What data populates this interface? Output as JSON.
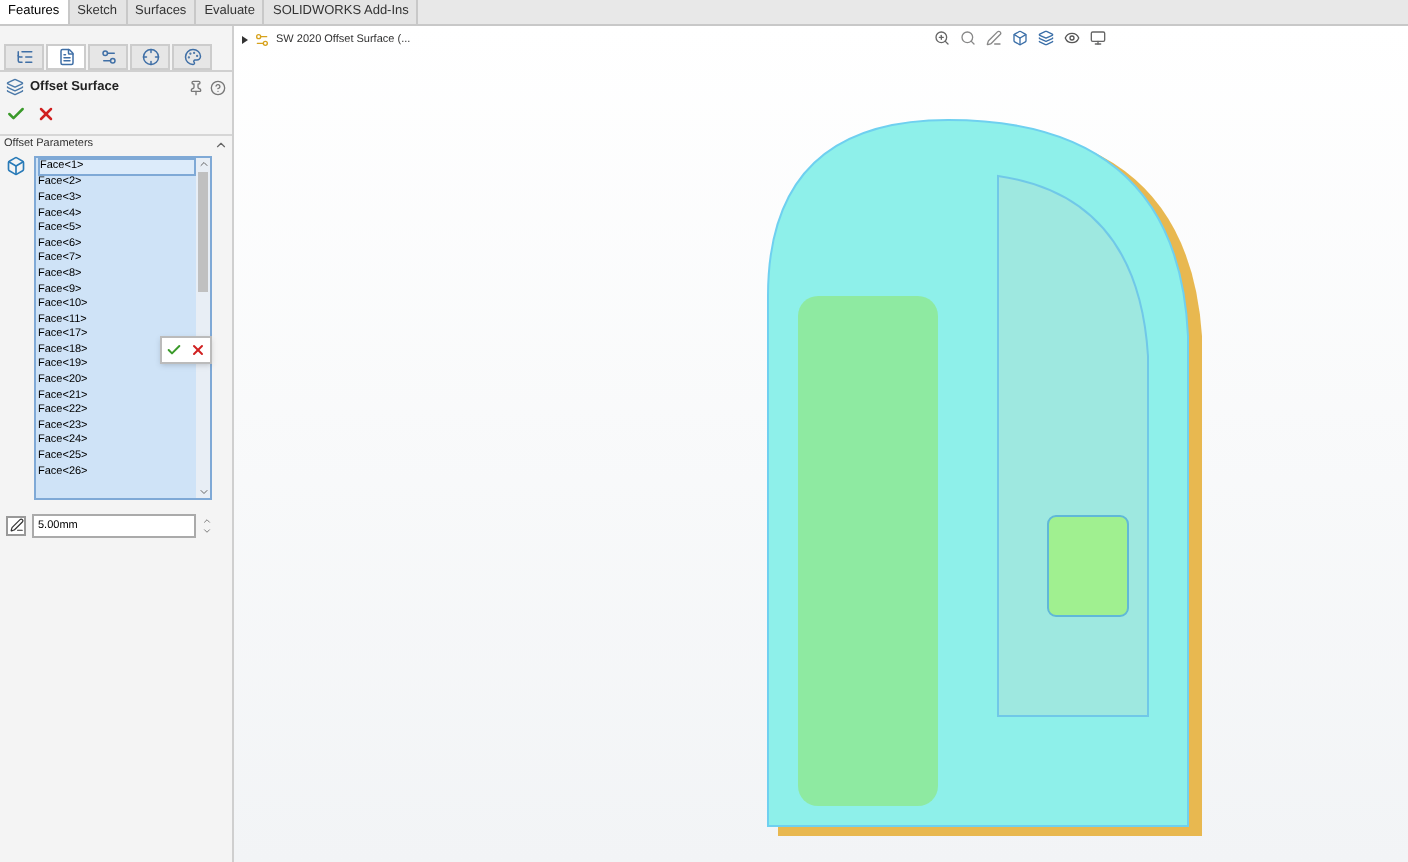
{
  "command_tabs": [
    {
      "label": "Features",
      "selected": true
    },
    {
      "label": "Sketch",
      "selected": false
    },
    {
      "label": "Surfaces",
      "selected": false
    },
    {
      "label": "Evaluate",
      "selected": false
    },
    {
      "label": "SOLIDWORKS Add-Ins",
      "selected": false
    }
  ],
  "manager_tabs": [
    {
      "kind": "feature",
      "selected": false
    },
    {
      "kind": "property",
      "selected": true
    },
    {
      "kind": "config",
      "selected": false
    },
    {
      "kind": "dim",
      "selected": false
    },
    {
      "kind": "display",
      "selected": false
    }
  ],
  "property_manager": {
    "title": "Offset Surface",
    "section": "Offset Parameters",
    "faces": [
      "Face<1>",
      "Face<2>",
      "Face<3>",
      "Face<4>",
      "Face<5>",
      "Face<6>",
      "Face<7>",
      "Face<8>",
      "Face<9>",
      "Face<10>",
      "Face<11>",
      "Face<17>",
      "Face<18>",
      "Face<19>",
      "Face<20>",
      "Face<21>",
      "Face<22>",
      "Face<23>",
      "Face<24>",
      "Face<25>",
      "Face<26>"
    ],
    "distance": "5.00mm"
  },
  "tree": {
    "root": "SW 2020 Offset Surface  (..."
  }
}
